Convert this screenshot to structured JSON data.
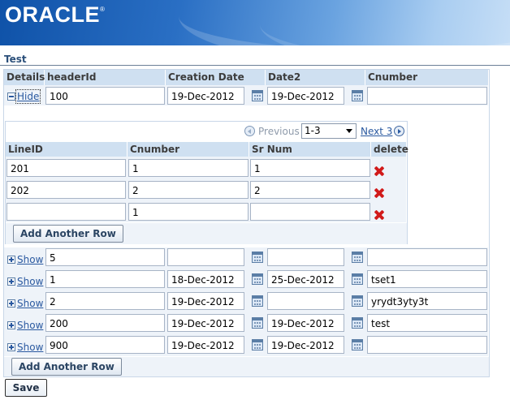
{
  "brand": {
    "logo_text": "ORACLE",
    "trademark": "®"
  },
  "page": {
    "title": "Test"
  },
  "outer_table": {
    "columns": [
      "Details",
      "headerId",
      "Creation Date",
      "Date2",
      "Cnumber"
    ],
    "rows": [
      {
        "toggle": "Hide",
        "headerId": "100",
        "creation_date": "19-Dec-2012",
        "date2": "19-Dec-2012",
        "cnumber": ""
      },
      {
        "toggle": "Show",
        "headerId": "5",
        "creation_date": "",
        "date2": "",
        "cnumber": ""
      },
      {
        "toggle": "Show",
        "headerId": "1",
        "creation_date": "18-Dec-2012",
        "date2": "25-Dec-2012",
        "cnumber": "tset1"
      },
      {
        "toggle": "Show",
        "headerId": "2",
        "creation_date": "19-Dec-2012",
        "date2": "",
        "cnumber": "yrydt3yty3t"
      },
      {
        "toggle": "Show",
        "headerId": "200",
        "creation_date": "19-Dec-2012",
        "date2": "19-Dec-2012",
        "cnumber": "test"
      },
      {
        "toggle": "Show",
        "headerId": "900",
        "creation_date": "19-Dec-2012",
        "date2": "19-Dec-2012",
        "cnumber": ""
      }
    ],
    "add_row_label": "Add Another Row"
  },
  "detail": {
    "nav": {
      "previous_label": "Previous",
      "range_value": "1-3",
      "next_label": "Next 3"
    },
    "columns": [
      "LineID",
      "Cnumber",
      "Sr Num",
      "delete"
    ],
    "rows": [
      {
        "line_id": "201",
        "cnumber": "1",
        "sr_num": "1"
      },
      {
        "line_id": "202",
        "cnumber": "2",
        "sr_num": "2"
      },
      {
        "line_id": "",
        "cnumber": "1",
        "sr_num": ""
      }
    ],
    "add_row_label": "Add Another Row"
  },
  "actions": {
    "save_label": "Save"
  },
  "colors": {
    "header_bg": "#cfe0f1",
    "link": "#2a59a0",
    "delete": "#d11a1a",
    "banner": "#0f52a8"
  }
}
